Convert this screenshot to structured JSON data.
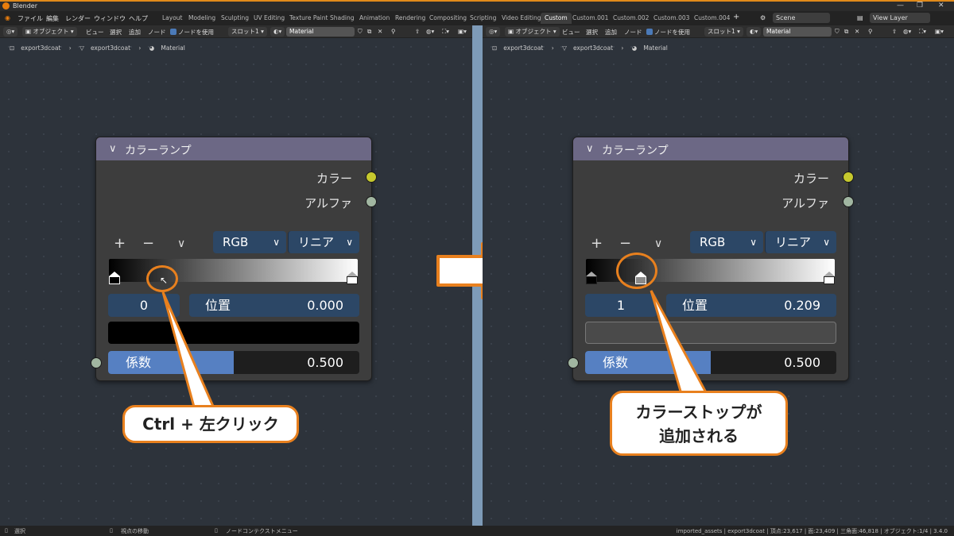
{
  "window": {
    "title": "Blender",
    "controls": [
      "—",
      "❐",
      "✕"
    ]
  },
  "menu": [
    "ファイル",
    "編集",
    "レンダー",
    "ウィンドウ",
    "ヘルプ"
  ],
  "workspaces": [
    "Layout",
    "Modeling",
    "Sculpting",
    "UV Editing",
    "Texture Paint",
    "Shading",
    "Animation",
    "Rendering",
    "Compositing",
    "Scripting",
    "Video Editing",
    "Custom",
    "Custom.001",
    "Custom.002",
    "Custom.003",
    "Custom.004"
  ],
  "active_workspace": "Custom",
  "scene": {
    "label": "Scene",
    "view_layer": "View Layer"
  },
  "editor_header": {
    "mode": "オブジェクト",
    "menus": [
      "ビュー",
      "選択",
      "追加",
      "ノード"
    ],
    "use_nodes": "ノードを使用",
    "slot": "スロット1",
    "material": "Material"
  },
  "breadcrumb": [
    "export3dcoat",
    "export3dcoat",
    "Material"
  ],
  "node": {
    "title": "カラーランプ",
    "out_color": "カラー",
    "out_alpha": "アルファ",
    "add": "+",
    "remove": "−",
    "menu": "∨",
    "color_mode": "RGB",
    "interpolation": "リニア",
    "pos_label": "位置",
    "factor_label": "係数",
    "factor_value": "0.500",
    "factor": 0.5
  },
  "left_panel": {
    "active_index": "0",
    "position": "0.000",
    "stops": [
      0.0,
      1.0
    ],
    "active_stop": 0,
    "active_color": "#000000",
    "callout": "Ctrl + 左クリック"
  },
  "right_panel": {
    "active_index": "1",
    "position": "0.209",
    "stops": [
      0.0,
      0.209,
      1.0
    ],
    "active_stop": 1,
    "active_color": "#4a4a4a",
    "callout_line1": "カラーストップが",
    "callout_line2": "追加される"
  },
  "status": {
    "select": "選択",
    "pan": "視点の移動",
    "context": "ノードコンテクストメニュー",
    "info": "imported_assets | export3dcoat | 頂点:23,617 | 面:23,409 | 三角面:46,818 | オブジェクト:1/4 | 3.4.0"
  },
  "colors": {
    "accent_orange": "#e8801e",
    "node_header": "#6c6885",
    "field_blue": "#2c4766",
    "factor_blue": "#5680c2",
    "divider": "#7e9bb8"
  }
}
